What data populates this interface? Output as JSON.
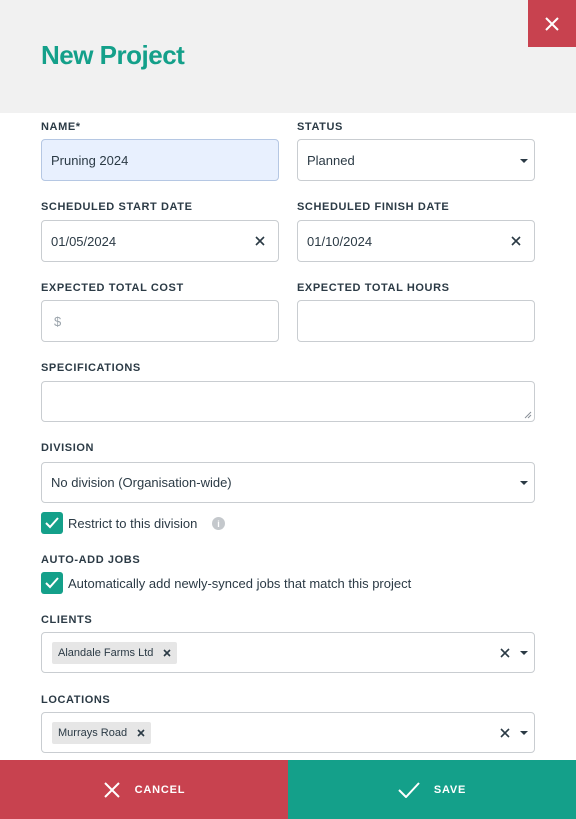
{
  "header": {
    "title": "New Project"
  },
  "form": {
    "name": {
      "label": "NAME*",
      "value": "Pruning 2024"
    },
    "status": {
      "label": "STATUS",
      "value": "Planned"
    },
    "start_date": {
      "label": "SCHEDULED START DATE",
      "value": "01/05/2024"
    },
    "finish_date": {
      "label": "SCHEDULED FINISH DATE",
      "value": "01/10/2024"
    },
    "total_cost": {
      "label": "EXPECTED TOTAL COST",
      "placeholder": "$",
      "value": ""
    },
    "total_hours": {
      "label": "EXPECTED TOTAL HOURS",
      "value": ""
    },
    "specifications": {
      "label": "SPECIFICATIONS",
      "value": ""
    },
    "division": {
      "label": "DIVISION",
      "value": "No division (Organisation-wide)"
    },
    "restrict_division": {
      "label": "Restrict to this division",
      "checked": true
    },
    "auto_add_jobs": {
      "label": "AUTO-ADD JOBS",
      "checkbox_label": "Automatically add newly-synced jobs that match this project",
      "checked": true
    },
    "clients": {
      "label": "CLIENTS",
      "chips": [
        "Alandale Farms Ltd"
      ]
    },
    "locations": {
      "label": "LOCATIONS",
      "chips": [
        "Murrays Road"
      ]
    }
  },
  "footer": {
    "cancel_label": "CANCEL",
    "save_label": "SAVE"
  },
  "colors": {
    "accent": "#14a08a",
    "danger": "#c8424f",
    "header_bg": "#f1f1f1"
  }
}
